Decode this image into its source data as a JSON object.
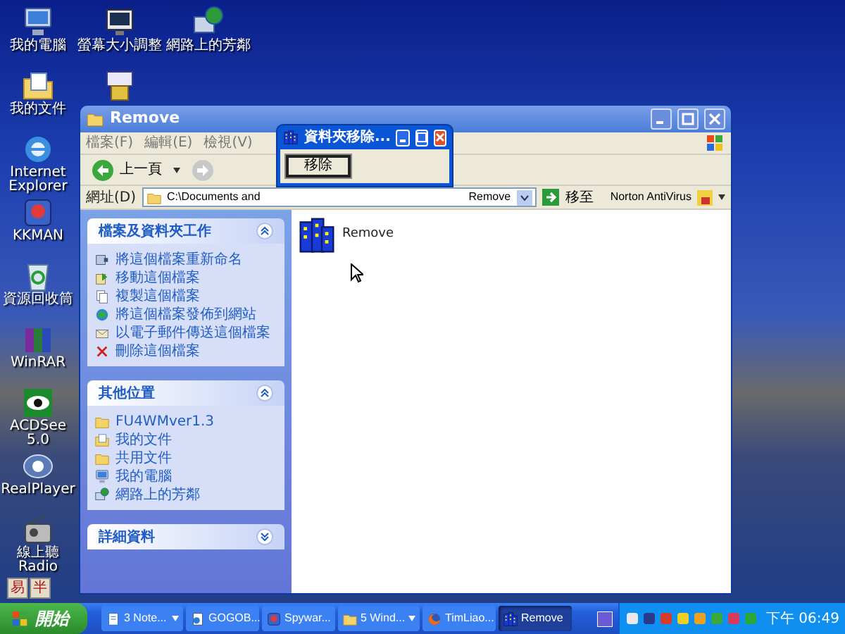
{
  "desktop": {
    "columns": [
      [
        {
          "label": "我的電腦",
          "kind": "computer"
        },
        {
          "label": "我的文件",
          "kind": "documents"
        },
        {
          "label": "Internet Explorer",
          "kind": "browser"
        },
        {
          "label": "KKMAN",
          "kind": "app"
        },
        {
          "label": "資源回收筒",
          "kind": "recycle"
        },
        {
          "label": "WinRAR",
          "kind": "books"
        },
        {
          "label": "ACDSee 5.0",
          "kind": "eye"
        },
        {
          "label": "RealPlayer",
          "kind": "player"
        },
        {
          "label": "線上聽Radio",
          "kind": "radio"
        }
      ],
      [
        {
          "label": "螢幕大小調整",
          "kind": "monitor"
        },
        {
          "kind": "package"
        }
      ],
      [
        {
          "label": "網路上的芳鄰",
          "kind": "network"
        }
      ]
    ],
    "ime_bar": [
      "易",
      "半"
    ]
  },
  "explorer": {
    "title": "Remove",
    "menu": [
      "檔案(F)",
      "編輯(E)",
      "檢視(V)"
    ],
    "back_label": "上一頁",
    "address": {
      "label": "網址(D)",
      "value_start": "C:\\Documents and",
      "value_end": "Remove",
      "go": "移至",
      "toolbar_label": "Norton AntiVirus"
    },
    "panels": [
      {
        "title": "檔案及資料夾工作",
        "expanded": true,
        "items": [
          {
            "label": "將這個檔案重新命名",
            "kind": "rename"
          },
          {
            "label": "移動這個檔案",
            "kind": "move"
          },
          {
            "label": "複製這個檔案",
            "kind": "copy"
          },
          {
            "label": "將這個檔案發佈到網站",
            "kind": "globe"
          },
          {
            "label": "以電子郵件傳送這個檔案",
            "kind": "mail"
          },
          {
            "label": "刪除這個檔案",
            "kind": "delete"
          }
        ]
      },
      {
        "title": "其他位置",
        "expanded": true,
        "items": [
          {
            "label": "FU4WMver1.3",
            "kind": "folder"
          },
          {
            "label": "我的文件",
            "kind": "documents"
          },
          {
            "label": "共用文件",
            "kind": "folder"
          },
          {
            "label": "我的電腦",
            "kind": "computer"
          },
          {
            "label": "網路上的芳鄰",
            "kind": "network"
          }
        ]
      },
      {
        "title": "詳細資料",
        "expanded": false
      }
    ],
    "files": [
      {
        "name": "Remove"
      }
    ]
  },
  "dialog": {
    "title": "資料夾移除...",
    "button": "移除"
  },
  "taskbar": {
    "start": "開始",
    "items": [
      {
        "label": "3 Note...",
        "kind": "notepad",
        "group": true,
        "selected": false
      },
      {
        "label": "GOGOB...",
        "kind": "page",
        "group": false,
        "selected": false
      },
      {
        "label": "Spywar...",
        "kind": "app",
        "group": false,
        "selected": false
      },
      {
        "label": "5 Wind...",
        "kind": "folder",
        "group": true,
        "selected": false
      },
      {
        "label": "TimLiao...",
        "kind": "firefox",
        "group": false,
        "selected": false
      },
      {
        "label": "Remove",
        "kind": "buildings",
        "group": false,
        "selected": true
      }
    ],
    "clock": "下午 06:49"
  }
}
